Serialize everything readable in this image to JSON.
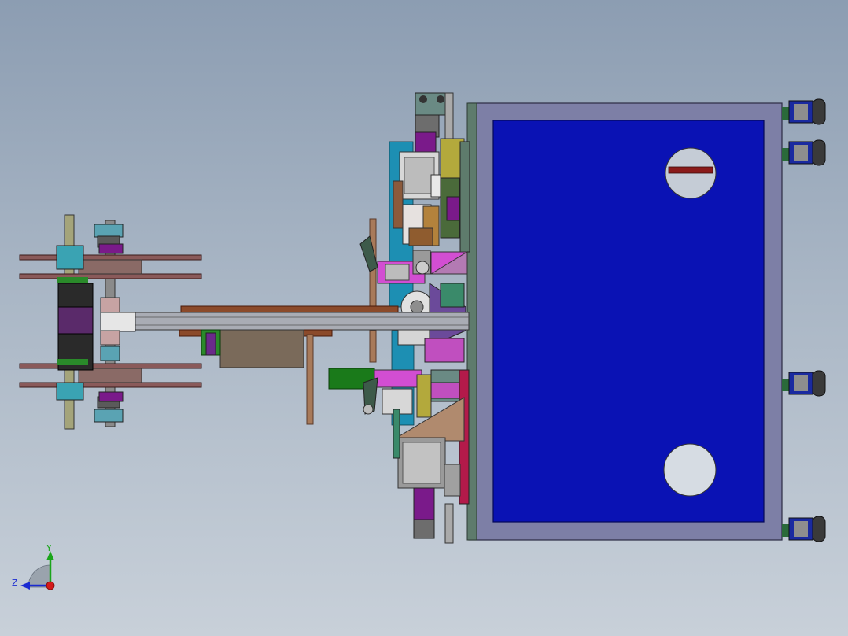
{
  "viewport": {
    "background_top": "#8c9db2",
    "background_bottom": "#c8d0d9",
    "panel_fill": "#0a12b4",
    "frame_fill": "#7d7fa6",
    "plate_fill": "#5e7b6c"
  },
  "triad": {
    "y_label": "Y",
    "z_label": "Z",
    "y_color": "#1aa51a",
    "z_color": "#1a2ad2",
    "x_color": "#d41a1a"
  }
}
